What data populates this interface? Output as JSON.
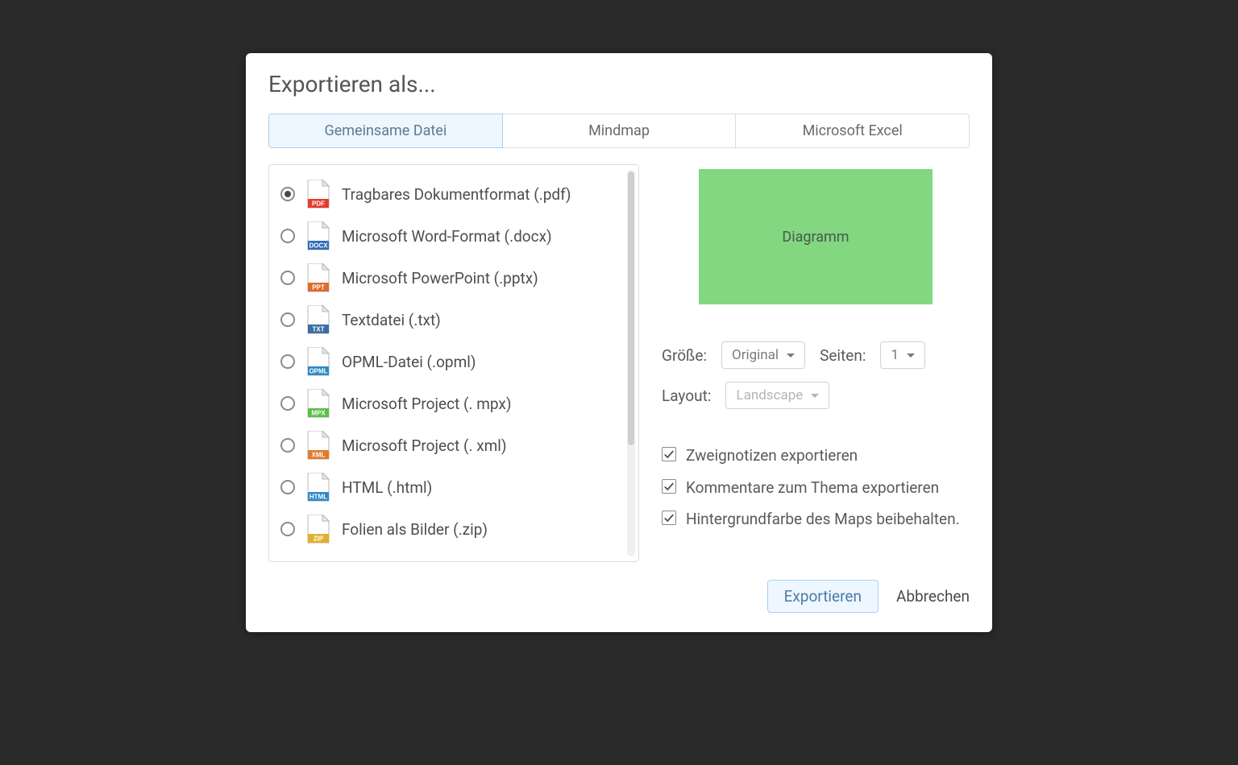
{
  "dialog": {
    "title": "Exportieren als...",
    "tabs": [
      {
        "label": "Gemeinsame Datei",
        "active": true
      },
      {
        "label": "Mindmap",
        "active": false
      },
      {
        "label": "Microsoft Excel",
        "active": false
      }
    ]
  },
  "formats": [
    {
      "label": "Tragbares Dokumentformat (.pdf)",
      "ext": "PDF",
      "color": "#e33c2f",
      "selected": true
    },
    {
      "label": "Microsoft Word-Format (.docx)",
      "ext": "DOCX",
      "color": "#2f6db5",
      "selected": false
    },
    {
      "label": "Microsoft PowerPoint (.pptx)",
      "ext": "PPT",
      "color": "#e06a2c",
      "selected": false
    },
    {
      "label": "Textdatei (.txt)",
      "ext": "TXT",
      "color": "#3a6fa5",
      "selected": false
    },
    {
      "label": "OPML-Datei (.opml)",
      "ext": "OPML",
      "color": "#2d89c8",
      "selected": false
    },
    {
      "label": "Microsoft Project (. mpx)",
      "ext": "MPX",
      "color": "#5bbf4a",
      "selected": false
    },
    {
      "label": "Microsoft Project (. xml)",
      "ext": "XML",
      "color": "#e07a2c",
      "selected": false
    },
    {
      "label": "HTML (.html)",
      "ext": "HTML",
      "color": "#2d89c8",
      "selected": false
    },
    {
      "label": "Folien als Bilder (.zip)",
      "ext": "ZIP",
      "color": "#e0b02c",
      "selected": false
    }
  ],
  "preview_label": "Diagramm",
  "options": {
    "size_label": "Größe:",
    "size_value": "Original",
    "pages_label": "Seiten:",
    "pages_value": "1",
    "layout_label": "Layout:",
    "layout_value": "Landscape"
  },
  "checks": [
    {
      "label": "Zweignotizen exportieren",
      "checked": true
    },
    {
      "label": "Kommentare zum Thema exportieren",
      "checked": true
    },
    {
      "label": "Hintergrundfarbe des Maps beibehalten.",
      "checked": true
    }
  ],
  "buttons": {
    "export": "Exportieren",
    "cancel": "Abbrechen"
  }
}
